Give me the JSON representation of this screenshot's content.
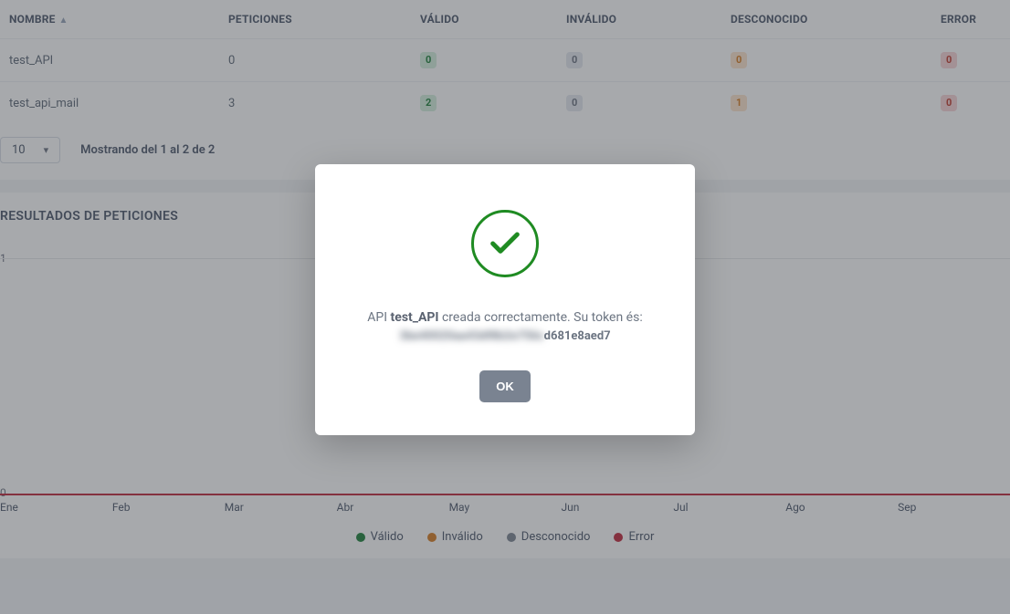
{
  "table": {
    "headers": {
      "name": "NOMBRE",
      "requests": "PETICIONES",
      "valid": "VÁLIDO",
      "invalid": "INVÁLIDO",
      "unknown": "DESCONOCIDO",
      "error": "ERROR"
    },
    "rows": [
      {
        "name": "test_API",
        "requests": "0",
        "valid": "0",
        "invalid": "0",
        "unknown": "0",
        "error": "0"
      },
      {
        "name": "test_api_mail",
        "requests": "3",
        "valid": "2",
        "invalid": "0",
        "unknown": "1",
        "error": "0"
      }
    ]
  },
  "pagination": {
    "page_size": "10",
    "info": "Mostrando del 1 al 2 de 2"
  },
  "chart_section": {
    "title": "RESULTADOS DE PETICIONES"
  },
  "chart_data": {
    "type": "line",
    "categories": [
      "Ene",
      "Feb",
      "Mar",
      "Abr",
      "May",
      "Jun",
      "Jul",
      "Ago",
      "Sep"
    ],
    "series": [
      {
        "name": "Válido",
        "color": "#1a7f37",
        "values": [
          0,
          0,
          0,
          0,
          0,
          0,
          0,
          0,
          0
        ]
      },
      {
        "name": "Inválido",
        "color": "#d57a1f",
        "values": [
          0,
          0,
          0,
          0,
          0,
          0,
          0,
          0,
          0
        ]
      },
      {
        "name": "Desconocido",
        "color": "#7a8391",
        "values": [
          0,
          0,
          0,
          0,
          0,
          0,
          0,
          0,
          0
        ]
      },
      {
        "name": "Error",
        "color": "#c0263a",
        "values": [
          0,
          0,
          0,
          0,
          0,
          0,
          0,
          0,
          0
        ]
      }
    ],
    "ylim": [
      0,
      1
    ],
    "y_ticks": [
      "1",
      "0"
    ],
    "xlabel": "",
    "ylabel": ""
  },
  "modal": {
    "msg_prefix": "API ",
    "api_name": "test_API",
    "msg_suffix": " creada correctamente. Su token és:",
    "token_hidden": "3be40020aa43df8b2e756c",
    "token_visible": "d681e8aed7",
    "ok": "OK"
  }
}
